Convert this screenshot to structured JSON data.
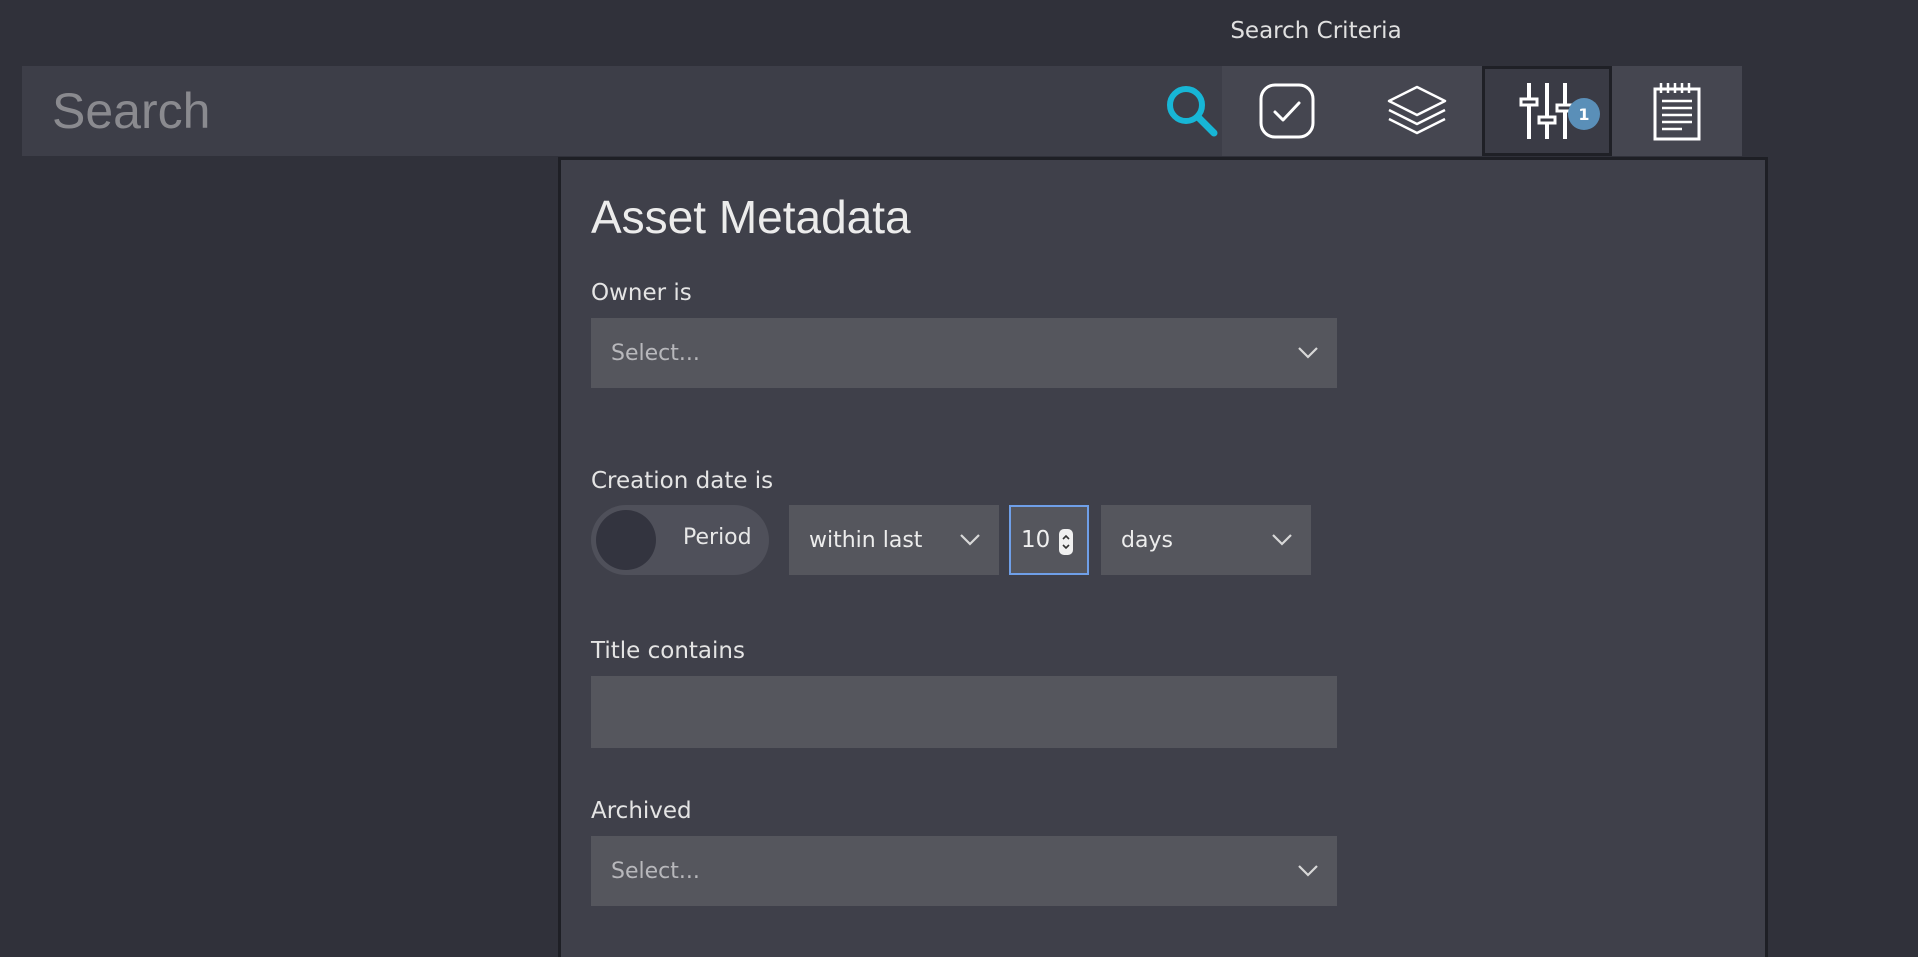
{
  "tooltip": "Search Criteria",
  "search": {
    "placeholder": "Search"
  },
  "toolbar": {
    "filter_count": "1",
    "accent_color": "#17b6d6"
  },
  "panel": {
    "title": "Asset Metadata",
    "owner": {
      "label": "Owner is",
      "placeholder": "Select..."
    },
    "creation_date": {
      "label": "Creation date is",
      "toggle_label": "Period",
      "operator": "within last",
      "amount": "10",
      "unit": "days"
    },
    "title_contains": {
      "label": "Title contains",
      "value": ""
    },
    "archived": {
      "label": "Archived",
      "placeholder": "Select..."
    }
  }
}
